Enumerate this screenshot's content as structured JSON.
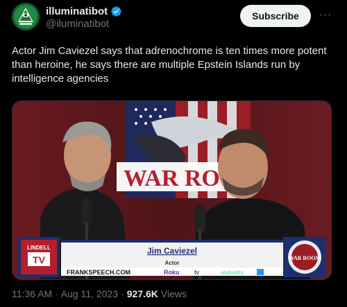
{
  "author": {
    "display_name": "illuminatibot",
    "handle": "@iluminatibot",
    "verified": true,
    "avatar_icon": "eye-pyramid-icon"
  },
  "actions": {
    "subscribe_label": "Subscribe",
    "more_label": "···"
  },
  "tweet": {
    "text": "Actor Jim Caviezel says that adrenochrome is ten times more potent than heroine, he says there are multiple Epstein Islands run by intelligence agencies"
  },
  "media": {
    "backdrop_text": "WAR ROO",
    "lower_third": {
      "name": "Jim Caviezel",
      "title": "Actor",
      "site": "FRANKSPEECH.COM",
      "platforms": [
        "Roku",
        "tv",
        "androidtv"
      ]
    },
    "left_logo_text": [
      "LINDELL",
      "TV"
    ],
    "right_logo_text": "WAR ROOM"
  },
  "meta": {
    "time": "11:36 AM",
    "separator": "·",
    "date": "Aug 11, 2023",
    "views_count": "927.6K",
    "views_label": "Views"
  },
  "colors": {
    "background": "#000000",
    "verified_blue": "#1d9bf0",
    "muted_text": "#71767b",
    "primary_text": "#e7e9ea"
  }
}
